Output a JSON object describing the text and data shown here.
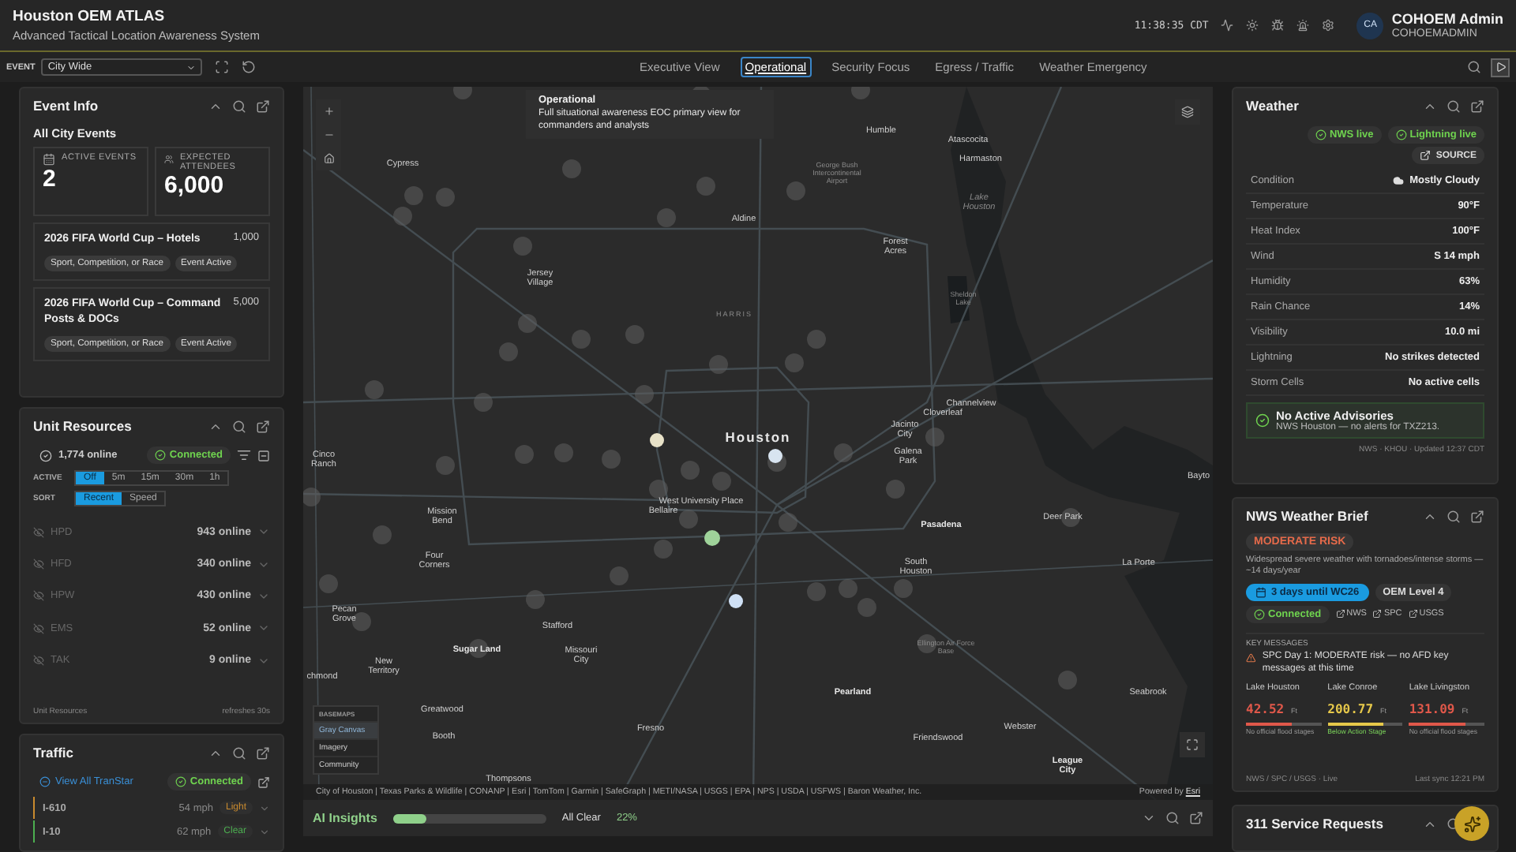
{
  "header": {
    "title": "Houston OEM ATLAS",
    "subtitle": "Advanced Tactical Location Awareness System",
    "clock": "11:38:35 CDT",
    "user": {
      "initials": "CA",
      "name": "COHOEM Admin",
      "username": "COHOEMADMIN"
    }
  },
  "toolbar": {
    "event_label": "EVENT",
    "event_value": "City Wide",
    "tabs": [
      {
        "label": "Executive View",
        "selected": false
      },
      {
        "label": "Operational",
        "selected": true
      },
      {
        "label": "Security Focus",
        "selected": false
      },
      {
        "label": "Egress / Traffic",
        "selected": false
      },
      {
        "label": "Weather Emergency",
        "selected": false
      }
    ]
  },
  "event_info": {
    "title": "Event Info",
    "subtitle": "All City Events",
    "stats": [
      {
        "kind": "calendar",
        "label": "ACTIVE EVENTS",
        "value": "2"
      },
      {
        "kind": "people",
        "label": "EXPECTED ATTENDEES",
        "value": "6,000"
      }
    ],
    "events": [
      {
        "name": "2026 FIFA World Cup – Hotels",
        "count": "1,000",
        "tags": [
          "Sport, Competition, or Race",
          "Event Active"
        ]
      },
      {
        "name": "2026 FIFA World Cup – Command Posts & DOCs",
        "count": "5,000",
        "tags": [
          "Sport, Competition, or Race",
          "Event Active"
        ]
      }
    ]
  },
  "unit_resources": {
    "title": "Unit Resources",
    "online": "1,774 online",
    "status": "Connected",
    "active_label": "ACTIVE",
    "active_options": [
      {
        "label": "Off",
        "selected": true
      },
      {
        "label": "5m",
        "selected": false
      },
      {
        "label": "15m",
        "selected": false
      },
      {
        "label": "30m",
        "selected": false
      },
      {
        "label": "1h",
        "selected": false
      }
    ],
    "sort_label": "SORT",
    "sort_options": [
      {
        "label": "Recent",
        "selected": true
      },
      {
        "label": "Speed",
        "selected": false
      }
    ],
    "units": [
      {
        "name": "HPD",
        "count": "943 online"
      },
      {
        "name": "HFD",
        "count": "340 online"
      },
      {
        "name": "HPW",
        "count": "430 online"
      },
      {
        "name": "EMS",
        "count": "52 online"
      },
      {
        "name": "TAK",
        "count": "9 online"
      }
    ],
    "footer_left": "Unit Resources",
    "footer_right": "refreshes 30s"
  },
  "traffic": {
    "title": "Traffic",
    "link": "View All TranStar",
    "status": "Connected",
    "roads": [
      {
        "name": "I-610",
        "speed": "54 mph",
        "condition": "Light",
        "color": "#c98a2e"
      },
      {
        "name": "I-10",
        "speed": "62 mph",
        "condition": "Clear",
        "color": "#4caf50"
      }
    ]
  },
  "tooltip": {
    "title": "Operational",
    "text": "Full situational awareness EOC primary view for commanders and analysts"
  },
  "map": {
    "labels": [
      {
        "text": "Humble",
        "kind": "town"
      },
      {
        "text": "Atascocita",
        "kind": "town"
      },
      {
        "text": "Harmaston",
        "kind": "town"
      },
      {
        "text": "Cypress",
        "kind": "town"
      },
      {
        "text": "George Bush Intercontinental Airport",
        "kind": "minor"
      },
      {
        "text": "Lake Houston",
        "kind": "water"
      },
      {
        "text": "Aldine",
        "kind": "town"
      },
      {
        "text": "Forest Acres",
        "kind": "town"
      },
      {
        "text": "Jersey Village",
        "kind": "town"
      },
      {
        "text": "Sheldon Lake",
        "kind": "minor"
      },
      {
        "text": "HARRIS",
        "kind": "county"
      },
      {
        "text": "Cloverleaf",
        "kind": "town"
      },
      {
        "text": "Channelview",
        "kind": "town"
      },
      {
        "text": "Houston",
        "kind": "city"
      },
      {
        "text": "Jacinto City",
        "kind": "town"
      },
      {
        "text": "Cinco Ranch",
        "kind": "town"
      },
      {
        "text": "Galena Park",
        "kind": "town"
      },
      {
        "text": "Mission Bend",
        "kind": "town"
      },
      {
        "text": "Bellaire",
        "kind": "town"
      },
      {
        "text": "West University Place",
        "kind": "town"
      },
      {
        "text": "Pasadena",
        "kind": "major"
      },
      {
        "text": "Deer Park",
        "kind": "town"
      },
      {
        "text": "Four Corners",
        "kind": "town"
      },
      {
        "text": "South Houston",
        "kind": "town"
      },
      {
        "text": "La Porte",
        "kind": "town"
      },
      {
        "text": "Pecan Grove",
        "kind": "town"
      },
      {
        "text": "Stafford",
        "kind": "town"
      },
      {
        "text": "Sugar Land",
        "kind": "major"
      },
      {
        "text": "Missouri City",
        "kind": "town"
      },
      {
        "text": "Ellington Air Force Base",
        "kind": "minor"
      },
      {
        "text": "New Territory",
        "kind": "town"
      },
      {
        "text": "chmond",
        "kind": "town"
      },
      {
        "text": "Pearland",
        "kind": "major"
      },
      {
        "text": "Seabrook",
        "kind": "town"
      },
      {
        "text": "Greatwood",
        "kind": "town"
      },
      {
        "text": "Booth",
        "kind": "town"
      },
      {
        "text": "Fresno",
        "kind": "town"
      },
      {
        "text": "Friendswood",
        "kind": "town"
      },
      {
        "text": "Webster",
        "kind": "town"
      },
      {
        "text": "League City",
        "kind": "major"
      },
      {
        "text": "Thompsons",
        "kind": "town"
      },
      {
        "text": "Bayto",
        "kind": "town"
      }
    ],
    "basemaps": {
      "title": "BASEMAPS",
      "items": [
        {
          "label": "Gray Canvas",
          "selected": true
        },
        {
          "label": "Imagery",
          "selected": false
        },
        {
          "label": "Community",
          "selected": false
        }
      ]
    },
    "attribution": "City of Houston | Texas Parks & Wildlife | CONANP | Esri | TomTom | Garmin | SafeGraph | METI/NASA | USGS | EPA | NPS | USDA | USFWS | Baron Weather, Inc.",
    "powered_prefix": "Powered by",
    "powered_link": "Esri"
  },
  "ai_insights": {
    "title": "AI Insights",
    "level": 0.22,
    "status": "All Clear",
    "percent": "22%"
  },
  "weather": {
    "title": "Weather",
    "feeds": [
      "NWS live",
      "Lightning live"
    ],
    "source": "SOURCE",
    "rows": [
      {
        "label": "Condition",
        "value": "Mostly Cloudy",
        "kind": "cloud"
      },
      {
        "label": "Temperature",
        "value": "90°F",
        "kind": "plain"
      },
      {
        "label": "Heat Index",
        "value": "100°F",
        "kind": "plain"
      },
      {
        "label": "Wind",
        "value": "S 14 mph",
        "kind": "plain"
      },
      {
        "label": "Humidity",
        "value": "63%",
        "kind": "plain"
      },
      {
        "label": "Rain Chance",
        "value": "14%",
        "kind": "plain"
      },
      {
        "label": "Visibility",
        "value": "10.0 mi",
        "kind": "plain"
      },
      {
        "label": "Lightning",
        "value": "No strikes detected",
        "kind": "plain"
      },
      {
        "label": "Storm Cells",
        "value": "No active cells",
        "kind": "plain"
      }
    ],
    "advisory_title": "No Active Advisories",
    "advisory_text": "NWS Houston — no alerts for TXZ213.",
    "footer": "NWS · KHOU · Updated 12:37 CDT"
  },
  "nws_brief": {
    "title": "NWS Weather Brief",
    "risk": "MODERATE RISK",
    "description": "Widespread severe weather with tornadoes/intense storms — ~14 days/year",
    "countdown": "3 days until WC26",
    "level": "OEM Level 4",
    "status": "Connected",
    "links": [
      "NWS",
      "SPC",
      "USGS"
    ],
    "key_label": "KEY MESSAGES",
    "key_message": "SPC Day 1: MODERATE risk — no AFD key messages at this time",
    "lakes": [
      {
        "name": "Lake Houston",
        "value": "42.52",
        "unit": "Ft",
        "level": 0.6,
        "color": "#e0584a",
        "note": "No official flood stages",
        "kind": "none"
      },
      {
        "name": "Lake Conroe",
        "value": "200.77",
        "unit": "Ft",
        "level": 0.75,
        "color": "#e6c84a",
        "note": "Below Action Stage",
        "kind": "below"
      },
      {
        "name": "Lake Livingston",
        "value": "131.09",
        "unit": "Ft",
        "level": 0.75,
        "color": "#e0584a",
        "note": "No official flood stages",
        "kind": "none"
      }
    ],
    "footer_left": "NWS / SPC / USGS · Live",
    "footer_right": "Last sync 12:21 PM"
  },
  "service_requests": {
    "title": "311 Service Requests"
  }
}
